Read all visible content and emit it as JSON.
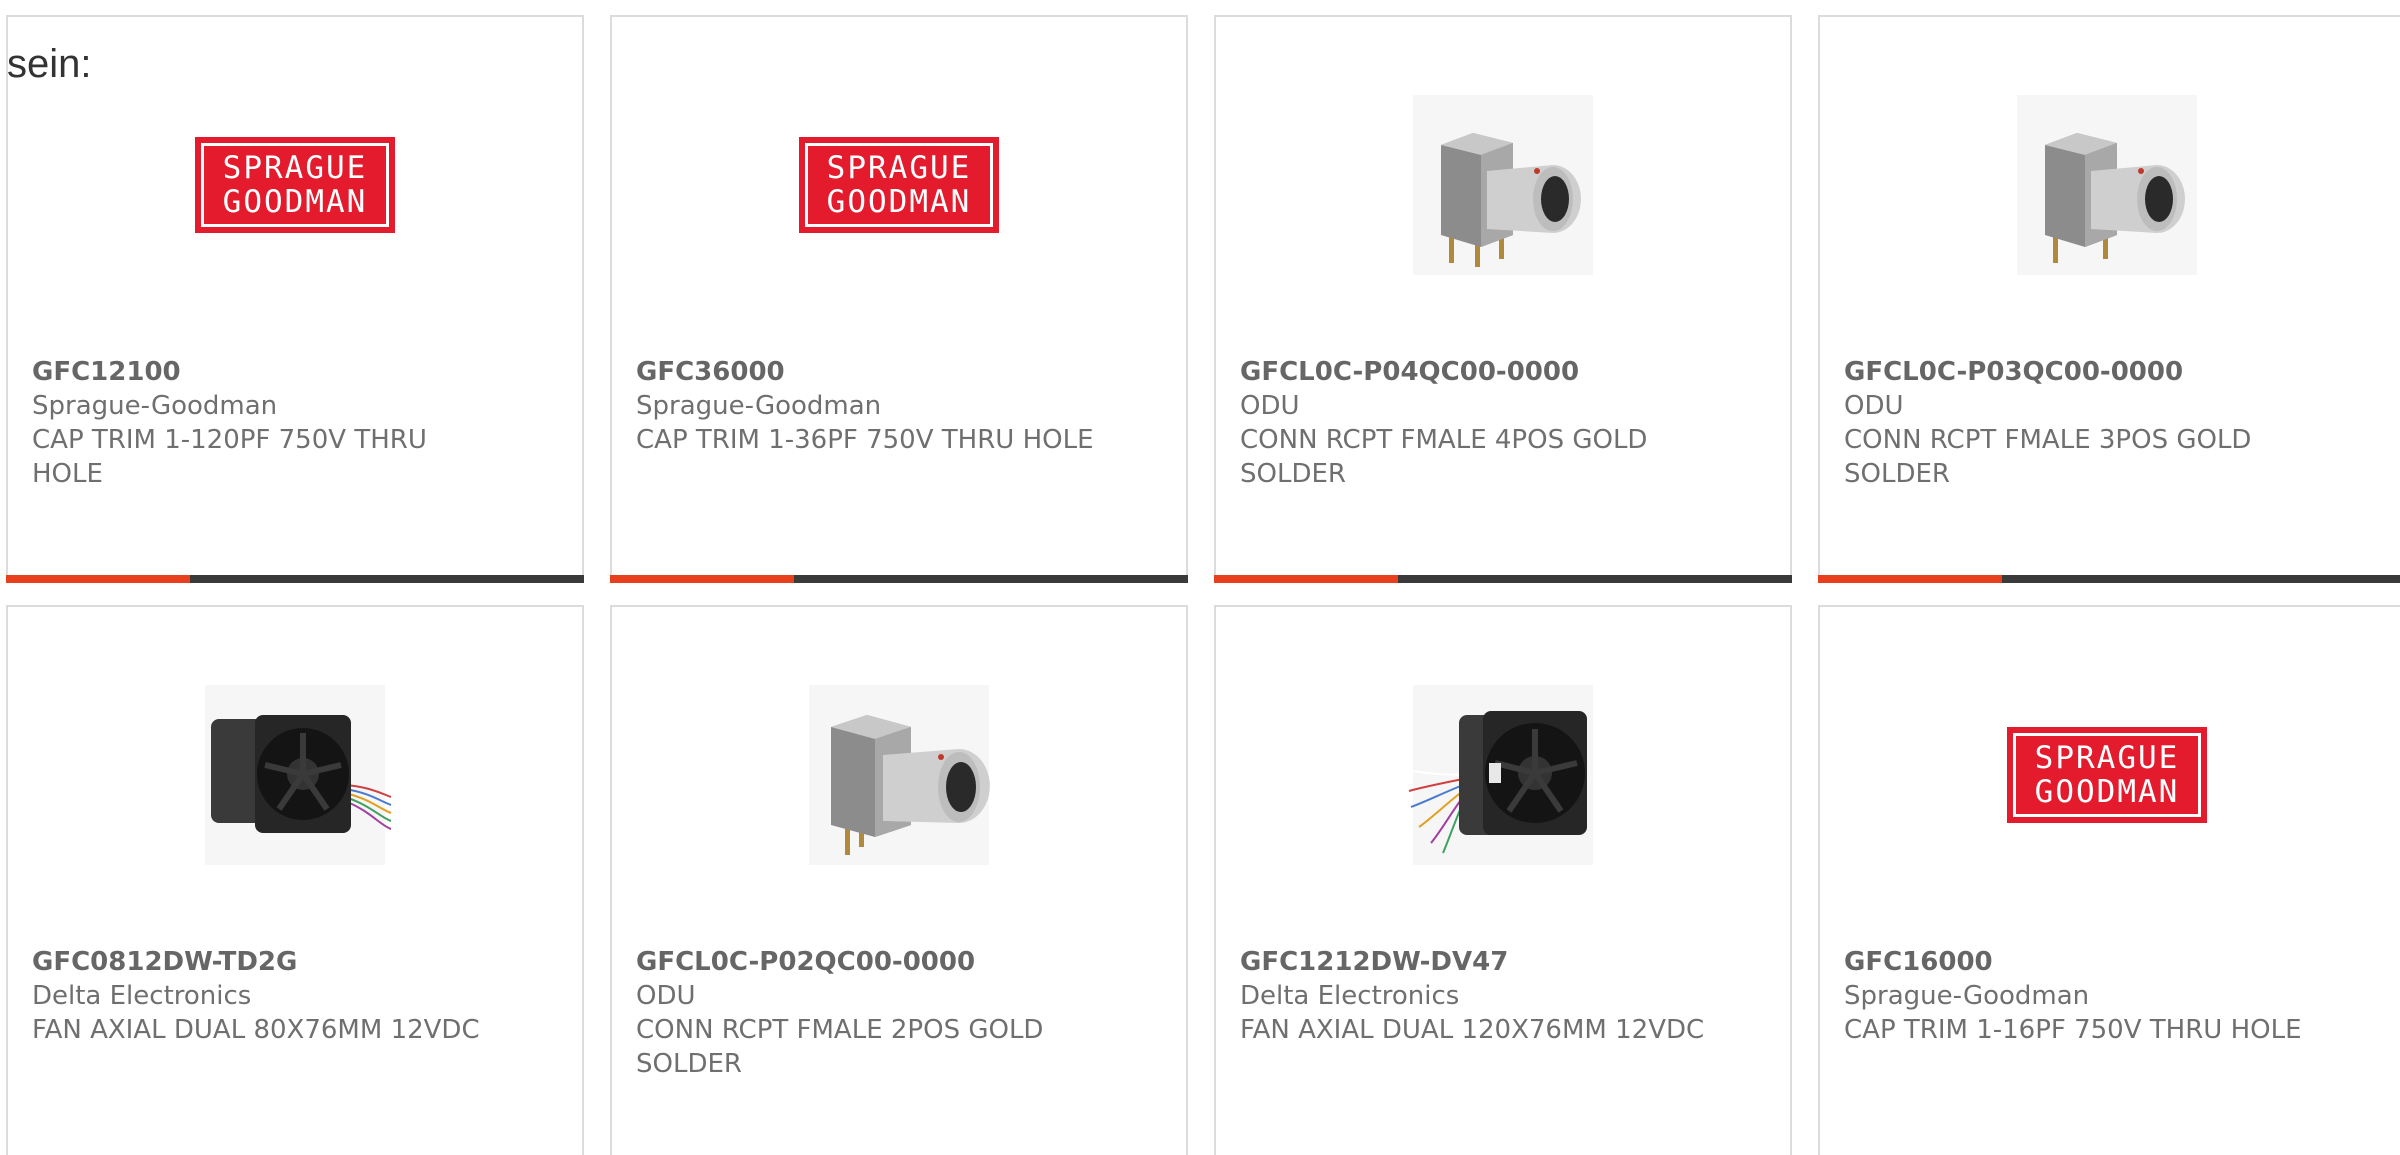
{
  "intro_text": "sein:",
  "accent_color": "#e8401c",
  "bar_color": "#3a3a3a",
  "logo": {
    "line1": "SPRAGUE",
    "line2": "GOODMAN"
  },
  "products": [
    {
      "part": "GFC12100",
      "manufacturer": "Sprague-Goodman",
      "description": "CAP TRIM 1-120PF 750V THRU HOLE",
      "image": "sprague-goodman-logo"
    },
    {
      "part": "GFC36000",
      "manufacturer": "Sprague-Goodman",
      "description": "CAP TRIM 1-36PF 750V THRU HOLE",
      "image": "sprague-goodman-logo"
    },
    {
      "part": "GFCL0C-P04QC00-0000",
      "manufacturer": "ODU",
      "description": "CONN RCPT FMALE 4POS GOLD SOLDER",
      "image": "connector-photo"
    },
    {
      "part": "GFCL0C-P03QC00-0000",
      "manufacturer": "ODU",
      "description": "CONN RCPT FMALE 3POS GOLD SOLDER",
      "image": "connector-photo"
    },
    {
      "part": "GFC0812DW-TD2G",
      "manufacturer": "Delta Electronics",
      "description": "FAN AXIAL DUAL 80X76MM 12VDC",
      "image": "fan-photo"
    },
    {
      "part": "GFCL0C-P02QC00-0000",
      "manufacturer": "ODU",
      "description": "CONN RCPT FMALE 2POS GOLD SOLDER",
      "image": "connector-photo"
    },
    {
      "part": "GFC1212DW-DV47",
      "manufacturer": "Delta Electronics",
      "description": "FAN AXIAL DUAL 120X76MM 12VDC",
      "image": "fan-photo"
    },
    {
      "part": "GFC16000",
      "manufacturer": "Sprague-Goodman",
      "description": "CAP TRIM 1-16PF 750V THRU HOLE",
      "image": "sprague-goodman-logo"
    }
  ]
}
